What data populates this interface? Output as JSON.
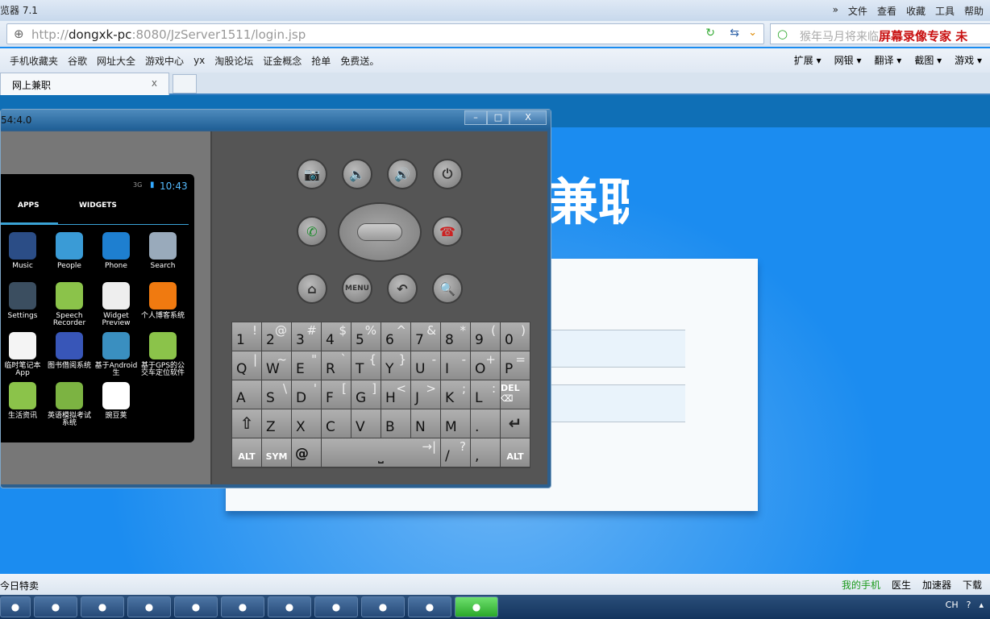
{
  "browser": {
    "title": "览器 7.1",
    "menu": [
      "»",
      "文件",
      "查看",
      "收藏",
      "工具",
      "帮助"
    ],
    "url_gray_prefix": "http://",
    "url_host": "dongxk-pc",
    "url_rest": ":8080/JzServer1511/login.jsp",
    "search_placeholder": "猴年马月将来临",
    "watermark": "屏幕录像专家 未",
    "bookmarks": [
      "手机收藏夹",
      "谷歌",
      "网址大全",
      "游戏中心",
      "yx",
      "淘股论坛",
      "证金概念",
      "抢单",
      "免费送。"
    ],
    "toolbar_right": [
      "扩展 ▾",
      "网银 ▾",
      "翻译 ▾",
      "截图 ▾",
      "游戏 ▾"
    ],
    "tab_label": "网上兼职",
    "tab_close": "x"
  },
  "page": {
    "title": "网上兼职",
    "accent": "#1b8cf0"
  },
  "emulator": {
    "title": "54:4.0",
    "buttons": {
      "min": "–",
      "max": "□",
      "close": "X"
    },
    "status_time": "10:43",
    "signal": "3G",
    "tabs": [
      "APPS",
      "WIDGETS"
    ],
    "apps": [
      {
        "label": "Music",
        "color": "#2b4d86"
      },
      {
        "label": "People",
        "color": "#3a9bd6"
      },
      {
        "label": "Phone",
        "color": "#1e7fd0"
      },
      {
        "label": "Search",
        "color": "#9ab"
      },
      {
        "label": "Settings",
        "color": "#3b4e60"
      },
      {
        "label": "Speech Recorder",
        "color": "#8bc34a"
      },
      {
        "label": "Widget Preview",
        "color": "#eee"
      },
      {
        "label": "个人博客系统",
        "color": "#f07a10"
      },
      {
        "label": "临时笔记本App",
        "color": "#f4f4f4"
      },
      {
        "label": "图书借阅系统",
        "color": "#3856b8"
      },
      {
        "label": "基于Android生",
        "color": "#3a8fc0"
      },
      {
        "label": "基于GPS的公交车定位软件",
        "color": "#8bc34a"
      },
      {
        "label": "生活资讯",
        "color": "#8bc34a"
      },
      {
        "label": "英语模拟考试系统",
        "color": "#7cb342"
      },
      {
        "label": "豌豆荚",
        "color": "#fff"
      }
    ],
    "controls": [
      {
        "name": "camera",
        "glyph": "📷"
      },
      {
        "name": "volume-down",
        "glyph": "🔈"
      },
      {
        "name": "volume-up",
        "glyph": "🔊"
      },
      {
        "name": "power",
        "glyph": "⏻"
      },
      {
        "name": "call",
        "glyph": "✆"
      },
      {
        "name": "end-call",
        "glyph": "☎"
      },
      {
        "name": "home",
        "glyph": "⌂"
      },
      {
        "name": "menu",
        "glyph": "MENU"
      },
      {
        "name": "back",
        "glyph": "↶"
      },
      {
        "name": "search",
        "glyph": "🔍"
      }
    ],
    "keys": [
      [
        "1",
        "!"
      ],
      [
        "2",
        "@"
      ],
      [
        "3",
        "#"
      ],
      [
        "4",
        "$"
      ],
      [
        "5",
        "%"
      ],
      [
        "6",
        "^"
      ],
      [
        "7",
        "&"
      ],
      [
        "8",
        "*"
      ],
      [
        "9",
        "("
      ],
      [
        "0",
        ")"
      ],
      [
        "Q",
        "|"
      ],
      [
        "W",
        "~"
      ],
      [
        "E",
        "\""
      ],
      [
        "R",
        "`"
      ],
      [
        "T",
        "{"
      ],
      [
        "Y",
        "}"
      ],
      [
        "U",
        "-"
      ],
      [
        "I",
        "-"
      ],
      [
        "O",
        "+"
      ],
      [
        "P",
        "="
      ],
      [
        "A",
        ""
      ],
      [
        "S",
        "\\"
      ],
      [
        "D",
        "'"
      ],
      [
        "F",
        "["
      ],
      [
        "G",
        "]"
      ],
      [
        "H",
        "<"
      ],
      [
        "J",
        ">"
      ],
      [
        "K",
        ";"
      ],
      [
        "L",
        ":"
      ],
      [
        "DEL ⌫",
        ""
      ],
      [
        "⇧",
        ""
      ],
      [
        "Z",
        ""
      ],
      [
        "X",
        ""
      ],
      [
        "C",
        ""
      ],
      [
        "V",
        ""
      ],
      [
        "B",
        ""
      ],
      [
        "N",
        ""
      ],
      [
        "M",
        ""
      ],
      [
        ".",
        ""
      ],
      [
        "↵",
        ""
      ],
      [
        "ALT",
        ""
      ],
      [
        "SYM",
        ""
      ],
      [
        "@",
        ""
      ],
      [
        "⎵",
        "→|"
      ],
      [
        "/",
        "?"
      ],
      [
        ",",
        ""
      ],
      [
        "ALT",
        ""
      ]
    ]
  },
  "statusbar": {
    "left": "今日特卖",
    "right": [
      "我的手机",
      "医生",
      "加速器",
      "下载"
    ]
  },
  "taskbar": {
    "tray": [
      "CH",
      "?",
      "▴"
    ]
  }
}
